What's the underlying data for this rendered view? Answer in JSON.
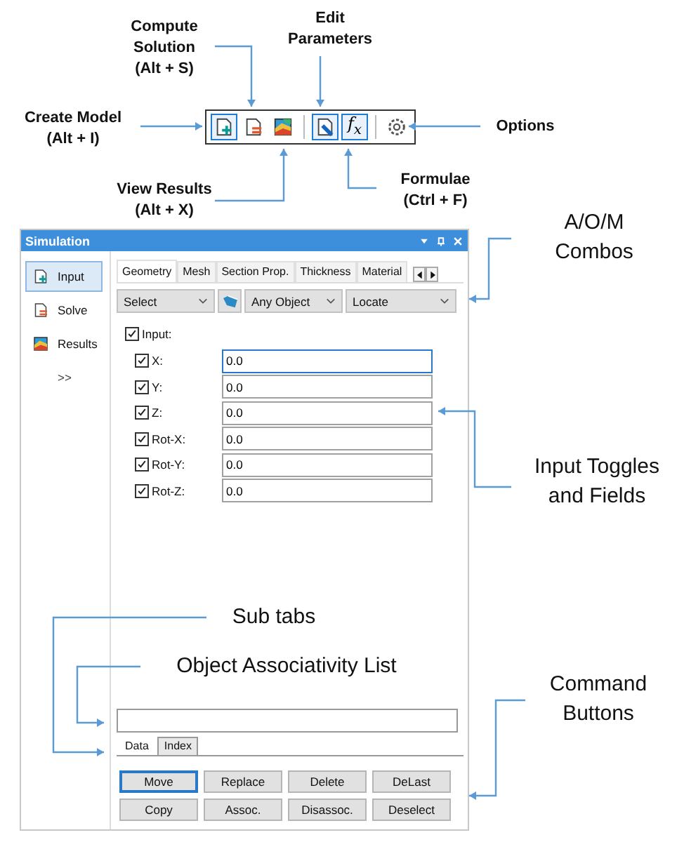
{
  "callouts": [
    {
      "lines": [
        "Compute",
        "Solution",
        "(Alt + S)"
      ]
    },
    {
      "lines": [
        "Edit",
        "Parameters"
      ]
    },
    {
      "lines": [
        "Create Model",
        "(Alt + I)"
      ]
    },
    {
      "lines": [
        "Options"
      ]
    },
    {
      "lines": [
        "View Results",
        "(Alt + X)"
      ]
    },
    {
      "lines": [
        "Formulae",
        "(Ctrl + F)"
      ]
    },
    {
      "lines": [
        "A/O/M",
        "Combos"
      ]
    },
    {
      "lines": [
        "Input Toggles",
        "and Fields"
      ]
    },
    {
      "lines": [
        "Sub tabs"
      ]
    },
    {
      "lines": [
        "Object Associativity List"
      ]
    },
    {
      "lines": [
        "Command",
        "Buttons"
      ]
    }
  ],
  "toolbar": {
    "buttons": [
      {
        "kind": "create",
        "selected": true
      },
      {
        "kind": "compute",
        "selected": false
      },
      {
        "kind": "results",
        "selected": false
      },
      {
        "kind": "separator"
      },
      {
        "kind": "edit",
        "selected": true
      },
      {
        "kind": "formula",
        "label": "f$_{x}$",
        "selected": true
      },
      {
        "kind": "separator"
      },
      {
        "kind": "options",
        "selected": false
      }
    ]
  },
  "panel": {
    "title": "Simulation",
    "sidebar": [
      {
        "kind": "create",
        "label": "Input",
        "selected": true
      },
      {
        "kind": "compute",
        "label": "Solve",
        "selected": false
      },
      {
        "kind": "results",
        "label": "Results",
        "selected": false
      }
    ],
    "more": ">>",
    "tabs": [
      {
        "label": "Geometry",
        "selected": true
      },
      {
        "label": "Mesh",
        "selected": false
      },
      {
        "label": "Section Prop.",
        "selected": false
      },
      {
        "label": "Thickness",
        "selected": false
      },
      {
        "label": "Material",
        "selected": false
      }
    ],
    "combos": [
      {
        "value": "Select"
      },
      {
        "value": "Any Object"
      },
      {
        "value": "Locate"
      }
    ],
    "input_toggle": {
      "label": "Input:",
      "checked": true
    },
    "fields": [
      {
        "label": "X:",
        "checked": true,
        "value": "0.0",
        "focused": true
      },
      {
        "label": "Y:",
        "checked": true,
        "value": "0.0",
        "focused": false
      },
      {
        "label": "Z:",
        "checked": true,
        "value": "0.0",
        "focused": false
      },
      {
        "label": "Rot-X:",
        "checked": true,
        "value": "0.0",
        "focused": false
      },
      {
        "label": "Rot-Y:",
        "checked": true,
        "value": "0.0",
        "focused": false
      },
      {
        "label": "Rot-Z:",
        "checked": true,
        "value": "0.0",
        "focused": false
      }
    ],
    "sub_tabs": [
      {
        "label": "Data",
        "selected": true
      },
      {
        "label": "Index",
        "selected": false
      }
    ],
    "buttons": [
      {
        "label": "Move",
        "focused": true
      },
      {
        "label": "Replace",
        "focused": false
      },
      {
        "label": "Delete",
        "focused": false
      },
      {
        "label": "DeLast",
        "focused": false
      },
      {
        "label": "Copy",
        "focused": false
      },
      {
        "label": "Assoc.",
        "focused": false
      },
      {
        "label": "Disassoc.",
        "focused": false
      },
      {
        "label": "Deselect",
        "focused": false
      }
    ]
  }
}
